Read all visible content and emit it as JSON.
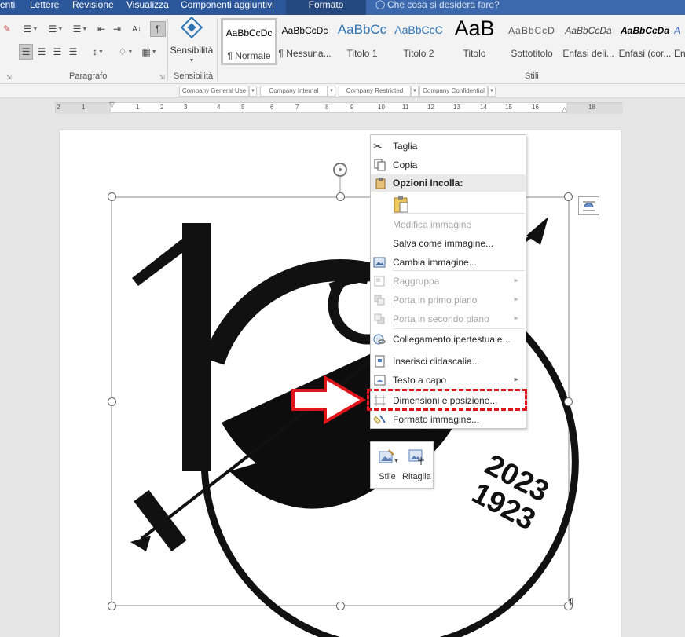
{
  "tabs": [
    {
      "label": "enti",
      "active": false
    },
    {
      "label": "Lettere",
      "active": false
    },
    {
      "label": "Revisione",
      "active": false
    },
    {
      "label": "Visualizza",
      "active": false
    },
    {
      "label": "Componenti aggiuntivi",
      "active": false
    },
    {
      "label": "Formato",
      "active": true
    }
  ],
  "tell_me": {
    "placeholder": "Che cosa si desidera fare?",
    "icon": "lightbulb-icon"
  },
  "ribbon": {
    "groups": {
      "paragraph": "Paragrafo",
      "sensitivity": "Sensibilità",
      "styles": "Stili"
    },
    "sensitivity_button": "Sensibilità",
    "styles": [
      {
        "sample": "AaBbCcDc",
        "name": "¶ Normale",
        "selected": true
      },
      {
        "sample": "AaBbCcDc",
        "name": "¶ Nessuna..."
      },
      {
        "sample": "AaBbCc",
        "name": "Titolo 1"
      },
      {
        "sample": "AaBbCcC",
        "name": "Titolo 2"
      },
      {
        "sample": "AaB",
        "name": "Titolo"
      },
      {
        "sample": "AaBbCcD",
        "name": "Sottotitolo"
      },
      {
        "sample": "AaBbCcDa",
        "name": "Enfasi deli..."
      },
      {
        "sample": "AaBbCcDa",
        "name": "Enfasi (cor..."
      },
      {
        "sample": "A",
        "name": "En"
      }
    ]
  },
  "classification_labels": [
    "Company General Use",
    "Company Internal",
    "Company Restricted",
    "Company Confidential"
  ],
  "ruler": {
    "numbers": [
      "2",
      "1",
      "1",
      "1",
      "2",
      "3",
      "4",
      "5",
      "6",
      "7",
      "8",
      "9",
      "10",
      "11",
      "12",
      "13",
      "14",
      "15",
      "16",
      "18"
    ]
  },
  "logo": {
    "year_top": "2023",
    "year_bottom": "1923"
  },
  "context_menu": {
    "items": [
      {
        "type": "item",
        "label": "Taglia",
        "icon": "scissors-icon",
        "disabled": false
      },
      {
        "type": "item",
        "label": "Copia",
        "icon": "copy-icon",
        "disabled": false
      },
      {
        "type": "header",
        "label": "Opzioni Incolla:",
        "icon": "clipboard-icon"
      },
      {
        "type": "paste-option",
        "icon": "paste-picture-icon"
      },
      {
        "type": "item",
        "label": "Modifica immagine",
        "icon": "",
        "disabled": true
      },
      {
        "type": "item",
        "label": "Salva come immagine...",
        "icon": "",
        "disabled": false
      },
      {
        "type": "item",
        "label": "Cambia immagine...",
        "icon": "change-picture-icon",
        "disabled": false,
        "submenu": false
      },
      {
        "type": "item",
        "label": "Raggruppa",
        "icon": "group-icon",
        "disabled": true,
        "submenu": true
      },
      {
        "type": "item",
        "label": "Porta in primo piano",
        "icon": "bring-forward-icon",
        "disabled": true,
        "submenu": true
      },
      {
        "type": "item",
        "label": "Porta in secondo piano",
        "icon": "send-backward-icon",
        "disabled": true,
        "submenu": true
      },
      {
        "type": "item",
        "label": "Collegamento ipertestuale...",
        "icon": "hyperlink-icon",
        "disabled": false
      },
      {
        "type": "item",
        "label": "Inserisci didascalia...",
        "icon": "caption-icon",
        "disabled": false
      },
      {
        "type": "item",
        "label": "Testo a capo",
        "icon": "wrap-text-icon",
        "disabled": false,
        "submenu": true
      },
      {
        "type": "item",
        "label": "Dimensioni e posizione...",
        "icon": "size-position-icon",
        "disabled": false,
        "highlighted": true
      },
      {
        "type": "item",
        "label": "Formato immagine...",
        "icon": "format-picture-icon",
        "disabled": false
      }
    ]
  },
  "mini_toolbar": {
    "style_label": "Stile",
    "crop_label": "Ritaglia"
  },
  "colors": {
    "title_bar": "#2b579a",
    "annotation": "#e0141b"
  }
}
